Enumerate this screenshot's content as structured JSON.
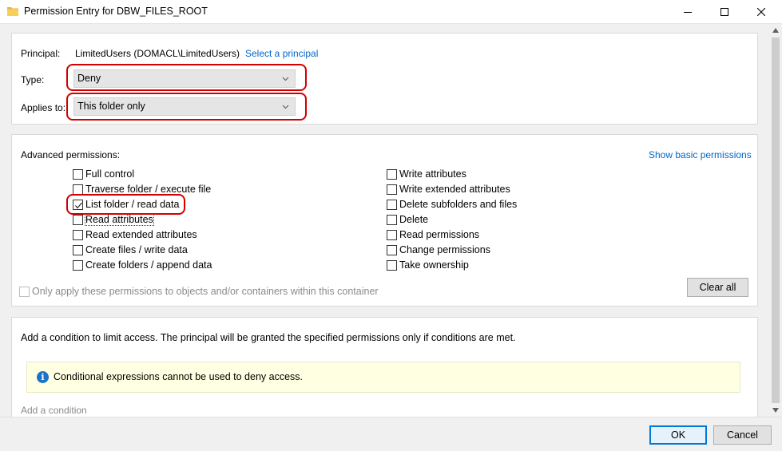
{
  "window": {
    "title": "Permission Entry for DBW_FILES_ROOT",
    "minimize_icon": "minimize-icon",
    "maximize_icon": "maximize-icon",
    "close_icon": "close-icon"
  },
  "principal": {
    "label": "Principal:",
    "value": "LimitedUsers (DOMACL\\LimitedUsers)",
    "select_link": "Select a principal"
  },
  "type": {
    "label": "Type:",
    "value": "Deny"
  },
  "applies_to": {
    "label": "Applies to:",
    "value": "This folder only"
  },
  "advanced": {
    "label": "Advanced permissions:",
    "show_basic_link": "Show basic permissions",
    "left": [
      {
        "label": "Full control",
        "checked": false
      },
      {
        "label": "Traverse folder / execute file",
        "checked": false
      },
      {
        "label": "List folder / read data",
        "checked": true
      },
      {
        "label": "Read attributes",
        "checked": false
      },
      {
        "label": "Read extended attributes",
        "checked": false
      },
      {
        "label": "Create files / write data",
        "checked": false
      },
      {
        "label": "Create folders / append data",
        "checked": false
      }
    ],
    "right": [
      {
        "label": "Write attributes",
        "checked": false
      },
      {
        "label": "Write extended attributes",
        "checked": false
      },
      {
        "label": "Delete subfolders and files",
        "checked": false
      },
      {
        "label": "Delete",
        "checked": false
      },
      {
        "label": "Read permissions",
        "checked": false
      },
      {
        "label": "Change permissions",
        "checked": false
      },
      {
        "label": "Take ownership",
        "checked": false
      }
    ],
    "only_apply_label": "Only apply these permissions to objects and/or containers within this container",
    "clear_all": "Clear all"
  },
  "condition": {
    "description": "Add a condition to limit access. The principal will be granted the specified permissions only if conditions are met.",
    "info_text": "Conditional expressions cannot be used to deny access.",
    "add_link": "Add a condition"
  },
  "footer": {
    "ok": "OK",
    "cancel": "Cancel"
  },
  "colors": {
    "accent": "#0078d7",
    "link": "#0066cc",
    "highlight_ring": "#d20000",
    "info_bg": "#ffffe1"
  }
}
